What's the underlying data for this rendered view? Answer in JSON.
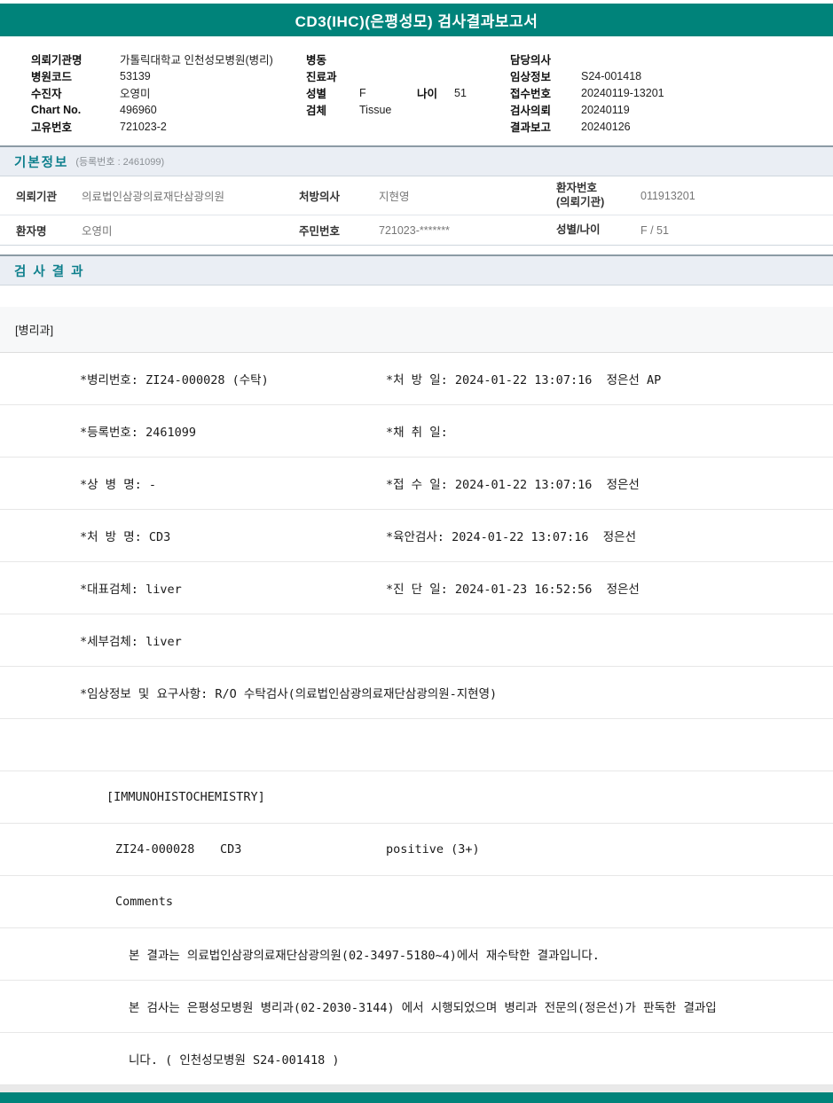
{
  "title": "CD3(IHC)(은평성모) 검사결과보고서",
  "theme": {
    "accent_teal": "#00837A",
    "section_bg": "#EAEEF4",
    "section_title_color": "#0D7F8C"
  },
  "header": {
    "col1": [
      {
        "label": "의뢰기관명",
        "value": "가톨릭대학교 인천성모병원(병리)"
      },
      {
        "label": "병원코드",
        "value": "53139"
      },
      {
        "label": "수진자",
        "value": "오영미"
      },
      {
        "label": "Chart No.",
        "value": "496960"
      },
      {
        "label": "고유번호",
        "value": "721023-2"
      }
    ],
    "col2": [
      {
        "label": "병동",
        "value": ""
      },
      {
        "label": "진료과",
        "value": ""
      },
      {
        "label": "성별",
        "value": "F",
        "label2": "나이",
        "value2": "51"
      },
      {
        "label": "검체",
        "value": "Tissue"
      }
    ],
    "col3": [
      {
        "label": "담당의사",
        "value": ""
      },
      {
        "label": "임상정보",
        "value": "S24-001418"
      },
      {
        "label": "접수번호",
        "value": "20240119-13201"
      },
      {
        "label": "검사의뢰",
        "value": "20240119"
      },
      {
        "label": "결과보고",
        "value": "20240126"
      }
    ]
  },
  "basic_info": {
    "section_title": "기본정보",
    "section_subtitle": "(등록번호 : 2461099)",
    "row1": {
      "c1_label": "의뢰기관",
      "c1_value": "의료법인삼광의료재단삼광의원",
      "c2_label": "처방의사",
      "c2_value": "지현영",
      "c3_label_line1": "환자번호",
      "c3_label_line2": "(의뢰기관)",
      "c3_value": "011913201"
    },
    "row2": {
      "c1_label": "환자명",
      "c1_value": "오영미",
      "c2_label": "주민번호",
      "c2_value": "721023-*******",
      "c3_label": "성별/나이",
      "c3_value": "F / 51"
    }
  },
  "results": {
    "section_title": "검 사 결 과",
    "department": "[병리과]",
    "rows": [
      {
        "left": "*병리번호: ZI24-000028 (수탁)",
        "right": "*처 방 일: 2024-01-22 13:07:16  정은선 AP"
      },
      {
        "left": "*등록번호: 2461099",
        "right": "*채 취 일:"
      },
      {
        "left": "*상 병 명: -",
        "right": "*접 수 일: 2024-01-22 13:07:16  정은선"
      },
      {
        "left": "*처 방 명: CD3",
        "right": "*육안검사: 2024-01-22 13:07:16  정은선"
      },
      {
        "left": "*대표검체: liver",
        "right": "*진 단 일: 2024-01-23 16:52:56  정은선"
      },
      {
        "left": "*세부검체: liver",
        "right": ""
      },
      {
        "full": "*임상정보 및 요구사항: R/O 수탁검사(의료법인삼광의료재단삼광의원-지현영)"
      },
      {
        "full": ""
      },
      {
        "full": "[IMMUNOHISTOCHEMISTRY]"
      },
      {
        "specimen_no": "ZI24-000028",
        "stain": "CD3",
        "result": "positive (3+)"
      },
      {
        "full": "Comments"
      },
      {
        "full": "본 결과는 의료법인삼광의료재단삼광의원(02-3497-5180~4)에서 재수탁한 결과입니다."
      },
      {
        "full": "본 검사는 은평성모병원 병리과(02-2030-3144) 에서 시행되었으며 병리과 전문의(정은선)가 판독한 결과입"
      },
      {
        "full": "니다. ( 인천성모병원 S24-001418 )"
      }
    ]
  }
}
